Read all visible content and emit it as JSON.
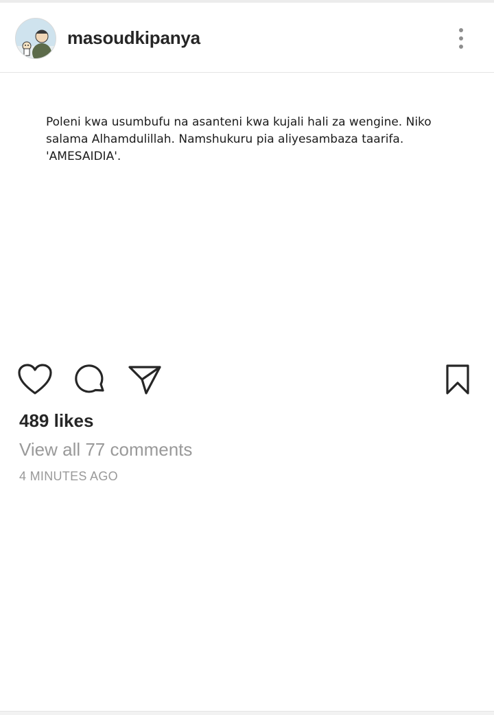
{
  "post": {
    "username": "masoudkipanya",
    "avatar_icon": "cartoon-avatar-icon",
    "more_icon": "more-vertical-icon",
    "image_text": "Poleni kwa usumbufu na asanteni  kwa kujali hali za wengine. Niko\nsalama Alhamdulillah. Namshukuru pia aliyesambaza taarifa.\n'AMESAIDIA'.",
    "actions": {
      "like_icon": "heart-icon",
      "comment_icon": "comment-icon",
      "share_icon": "send-icon",
      "save_icon": "bookmark-icon"
    },
    "likes_text": "489 likes",
    "view_comments_text": "View all 77 comments",
    "timestamp": "4 MINUTES AGO"
  },
  "colors": {
    "text_primary": "#262626",
    "text_secondary": "#999999",
    "divider": "#e4e4e4"
  }
}
